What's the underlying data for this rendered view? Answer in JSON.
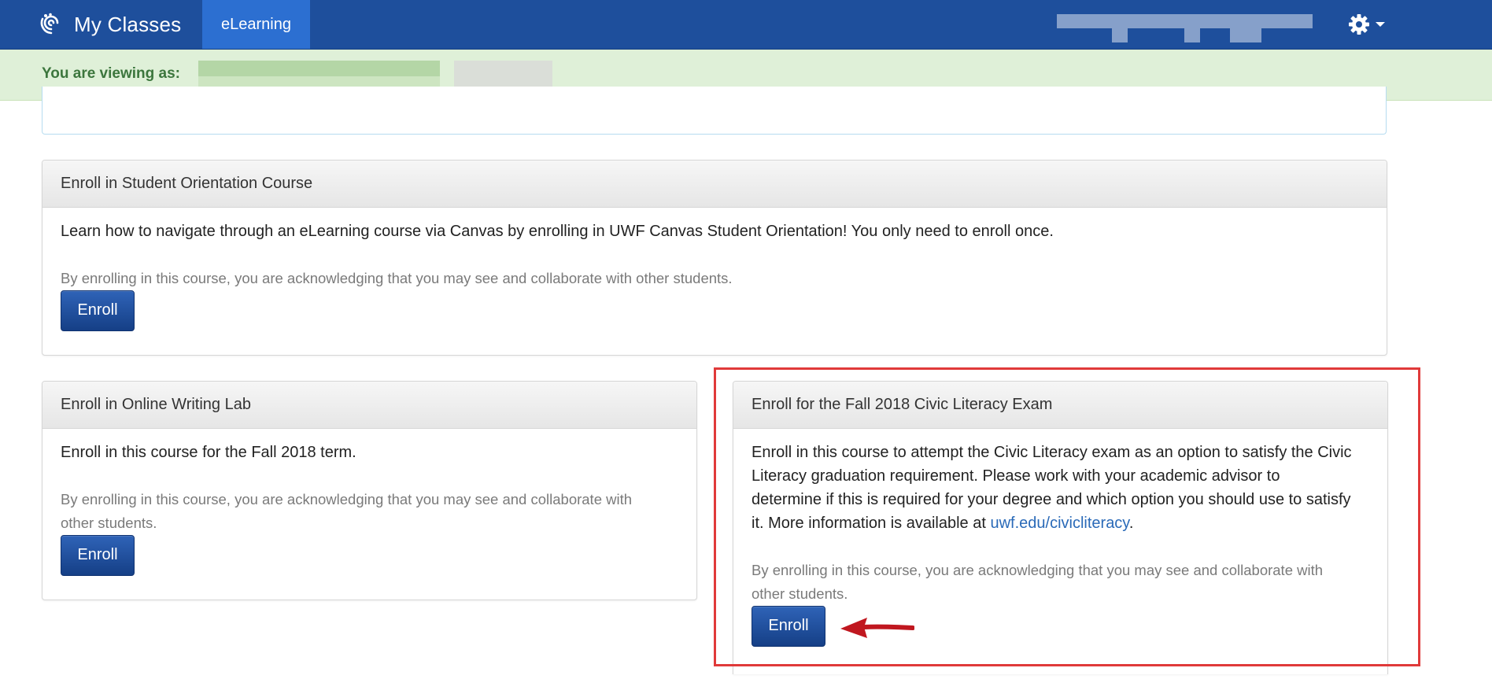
{
  "navbar": {
    "brand_title": "My Classes",
    "active_tab": "eLearning",
    "bg_color": "#1e4f9c",
    "tab_color": "#2c6fd1"
  },
  "banner": {
    "label": "You are viewing as:"
  },
  "panels": {
    "orientation": {
      "title": "Enroll in Student Orientation Course",
      "description": "Learn how to navigate through an eLearning course via Canvas by enrolling in UWF Canvas Student Orientation! You only need to enroll once.",
      "note": "By enrolling in this course, you are acknowledging that you may see and collaborate with other students.",
      "button_label": "Enroll"
    },
    "writing_lab": {
      "title": "Enroll in Online Writing Lab",
      "description": "Enroll in this course for the Fall 2018 term.",
      "note": "By enrolling in this course, you are acknowledging that you may see and collaborate with other students.",
      "button_label": "Enroll"
    },
    "civic_literacy": {
      "title": "Enroll for the Fall 2018 Civic Literacy Exam",
      "description_before_link": "Enroll in this course to attempt the Civic Literacy exam as an option to satisfy the Civic Literacy graduation requirement. Please work with your academic advisor to determine if this is required for your degree and which option you should use to satisfy it. More information is available at ",
      "link_text": "uwf.edu/civicliteracy",
      "description_after_link": ".",
      "note": "By enrolling in this course, you are acknowledging that you may see and collaborate with other students.",
      "button_label": "Enroll"
    }
  },
  "colors": {
    "highlight": "#e03a3a",
    "arrow": "#c0171f",
    "banner_bg": "#dff0d8",
    "banner_text": "#3c763d",
    "link": "#2a6ab8"
  },
  "icons": {
    "brand": "swirl-logo-icon",
    "settings": "gear-icon",
    "settings_caret": "caret-down-icon",
    "pointer": "red-arrow-icon"
  }
}
